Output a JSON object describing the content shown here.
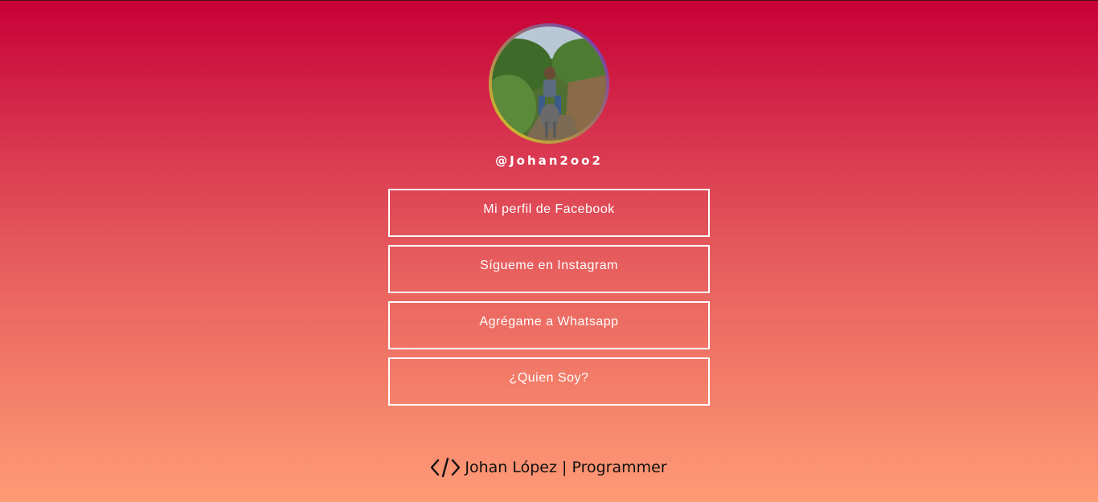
{
  "profile": {
    "handle": "@Johan2oo2"
  },
  "links": [
    {
      "label": "Mi perfil de Facebook"
    },
    {
      "label": "Sígueme en Instagram"
    },
    {
      "label": "Agrégame a Whatsapp"
    },
    {
      "label": "¿Quien Soy?"
    }
  ],
  "footer": {
    "icon": "code-icon",
    "text": "Johan López | Programmer"
  },
  "colors": {
    "gradient_top": "#c70035",
    "gradient_bottom": "#ff9b76",
    "ring_start": "#6a2fc9",
    "ring_end": "#d8cf1e",
    "text": "#ffffff"
  }
}
